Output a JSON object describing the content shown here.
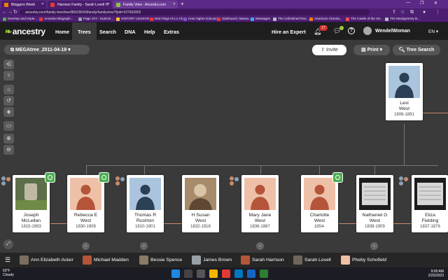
{
  "browser": {
    "tabs": [
      {
        "title": "Bloggers Weeb",
        "color": "#f57c00"
      },
      {
        "title": "Harrison Family - Sarah Lovell H",
        "color": "#e53935"
      },
      {
        "title": "Family View - Ancestry.com",
        "color": "#8bc34a"
      }
    ],
    "url": "ancestry.com/family-tree/tree/86629043/family/familyview?fpid=197652802",
    "bookmarks": [
      {
        "label": "Develop and Imple...",
        "color": "#4caf50"
      },
      {
        "label": "Ancestor Biograph...",
        "color": "#e53935"
      },
      {
        "label": "Page 374 - Hutchin...",
        "color": "#90a4ae"
      },
      {
        "label": "HISTORY LESSON E...",
        "color": "#fbc02d"
      },
      {
        "label": "Red Flags Hi-Lo Ch...",
        "color": "#e53935"
      },
      {
        "label": "How Higher Educati...",
        "color": "#7e57c2"
      },
      {
        "label": "Sideboard | Museu...",
        "color": "#e53935"
      },
      {
        "label": "Messages",
        "color": "#42a5f5"
      },
      {
        "label": "The Unfinished Rev...",
        "color": "#bdbdbd"
      },
      {
        "label": "American Victoria...",
        "color": "#f57c00"
      },
      {
        "label": "The Castle of the Str...",
        "color": "#ef5350"
      },
      {
        "label": "The Montgomery B...",
        "color": "#bdbdbd"
      }
    ]
  },
  "app": {
    "logo": "ancestry",
    "nav": [
      "Home",
      "Trees",
      "Search",
      "DNA",
      "Help",
      "Extras"
    ],
    "hire": "Hire an Expert",
    "notifications": "17",
    "username": "WendelWoman",
    "lang": "EN"
  },
  "toolbar": {
    "tree_name": "MEGAtree_2011-04-19",
    "invite": "Invite",
    "print": "Print",
    "tree_search": "Tree Search"
  },
  "cards": [
    {
      "name": "Levi\nWest",
      "dates": "1806-1891",
      "photo": "silhouette-male"
    },
    {
      "name": "Joseph\nMcLellan",
      "dates": "1815-1893",
      "photo": "photo-grave"
    },
    {
      "name": "Rebecca E\nWest",
      "dates": "1830-1908",
      "photo": "silhouette-female"
    },
    {
      "name": "Thomas R\nRushton",
      "dates": "1810-1901",
      "photo": "silhouette-male"
    },
    {
      "name": "H Susan\nWest",
      "dates": "1832-1918",
      "photo": "photo-portrait"
    },
    {
      "name": "Mary Jane\nWest",
      "dates": "1836-1867",
      "photo": "silhouette-female"
    },
    {
      "name": "Charlotte\nWest",
      "dates": "1854-",
      "photo": "silhouette-female"
    },
    {
      "name": "Nathaniel G\nWest",
      "dates": "1838-1909",
      "photo": "photo-document"
    },
    {
      "name": "Eliza\nFielding",
      "dates": "1837-1876",
      "photo": "photo-document"
    }
  ],
  "people_bar": [
    "Ann Elizabeth Acker",
    "Michael Madden",
    "Bessie Spence",
    "James Brown",
    "Sarah Harrison",
    "Sarah Lovell",
    "Pheby Schofield"
  ],
  "taskbar": {
    "temp": "63°F",
    "condition": "Cloudy",
    "time": "9:00 AM",
    "date": "2/25/2023"
  }
}
